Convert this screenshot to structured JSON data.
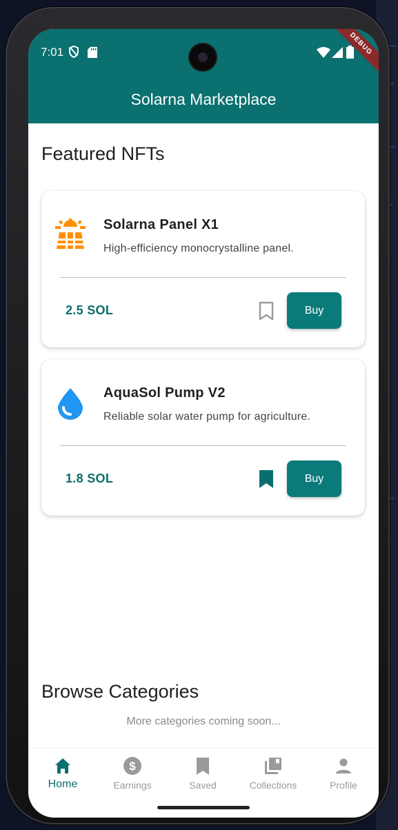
{
  "status_bar": {
    "time": "7:01"
  },
  "debug_label": "DEBUG",
  "app_bar": {
    "title": "Solarna Marketplace"
  },
  "featured": {
    "heading": "Featured NFTs",
    "items": [
      {
        "icon": "solar-panel-icon",
        "title": "Solarna Panel X1",
        "description": "High-efficiency monocrystalline panel.",
        "price": "2.5 SOL",
        "saved": false,
        "buy_label": "Buy"
      },
      {
        "icon": "water-drop-icon",
        "title": "AquaSol Pump V2",
        "description": "Reliable solar water pump for agriculture.",
        "price": "1.8 SOL",
        "saved": true,
        "buy_label": "Buy"
      }
    ]
  },
  "categories": {
    "heading": "Browse Categories",
    "placeholder": "More categories coming soon..."
  },
  "nav": {
    "items": [
      {
        "label": "Home",
        "icon": "home-icon",
        "active": true
      },
      {
        "label": "Earnings",
        "icon": "dollar-icon",
        "active": false
      },
      {
        "label": "Saved",
        "icon": "bookmark-icon",
        "active": false
      },
      {
        "label": "Collections",
        "icon": "collections-icon",
        "active": false
      },
      {
        "label": "Profile",
        "icon": "person-icon",
        "active": false
      }
    ]
  },
  "colors": {
    "primary": "#0b7070",
    "button": "#0b7a7a",
    "solar_orange": "#ff8f00",
    "water_blue": "#2196f3"
  }
}
